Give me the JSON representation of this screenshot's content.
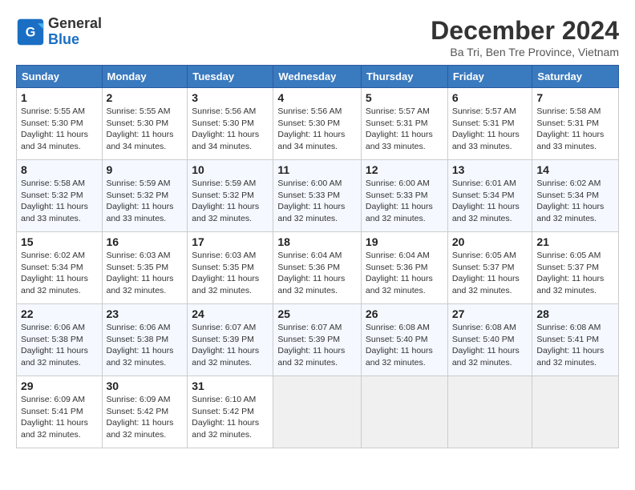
{
  "header": {
    "logo_line1": "General",
    "logo_line2": "Blue",
    "month_title": "December 2024",
    "location": "Ba Tri, Ben Tre Province, Vietnam"
  },
  "weekdays": [
    "Sunday",
    "Monday",
    "Tuesday",
    "Wednesday",
    "Thursday",
    "Friday",
    "Saturday"
  ],
  "weeks": [
    [
      {
        "day": "1",
        "text": "Sunrise: 5:55 AM\nSunset: 5:30 PM\nDaylight: 11 hours\nand 34 minutes."
      },
      {
        "day": "2",
        "text": "Sunrise: 5:55 AM\nSunset: 5:30 PM\nDaylight: 11 hours\nand 34 minutes."
      },
      {
        "day": "3",
        "text": "Sunrise: 5:56 AM\nSunset: 5:30 PM\nDaylight: 11 hours\nand 34 minutes."
      },
      {
        "day": "4",
        "text": "Sunrise: 5:56 AM\nSunset: 5:30 PM\nDaylight: 11 hours\nand 34 minutes."
      },
      {
        "day": "5",
        "text": "Sunrise: 5:57 AM\nSunset: 5:31 PM\nDaylight: 11 hours\nand 33 minutes."
      },
      {
        "day": "6",
        "text": "Sunrise: 5:57 AM\nSunset: 5:31 PM\nDaylight: 11 hours\nand 33 minutes."
      },
      {
        "day": "7",
        "text": "Sunrise: 5:58 AM\nSunset: 5:31 PM\nDaylight: 11 hours\nand 33 minutes."
      }
    ],
    [
      {
        "day": "8",
        "text": "Sunrise: 5:58 AM\nSunset: 5:32 PM\nDaylight: 11 hours\nand 33 minutes."
      },
      {
        "day": "9",
        "text": "Sunrise: 5:59 AM\nSunset: 5:32 PM\nDaylight: 11 hours\nand 33 minutes."
      },
      {
        "day": "10",
        "text": "Sunrise: 5:59 AM\nSunset: 5:32 PM\nDaylight: 11 hours\nand 32 minutes."
      },
      {
        "day": "11",
        "text": "Sunrise: 6:00 AM\nSunset: 5:33 PM\nDaylight: 11 hours\nand 32 minutes."
      },
      {
        "day": "12",
        "text": "Sunrise: 6:00 AM\nSunset: 5:33 PM\nDaylight: 11 hours\nand 32 minutes."
      },
      {
        "day": "13",
        "text": "Sunrise: 6:01 AM\nSunset: 5:34 PM\nDaylight: 11 hours\nand 32 minutes."
      },
      {
        "day": "14",
        "text": "Sunrise: 6:02 AM\nSunset: 5:34 PM\nDaylight: 11 hours\nand 32 minutes."
      }
    ],
    [
      {
        "day": "15",
        "text": "Sunrise: 6:02 AM\nSunset: 5:34 PM\nDaylight: 11 hours\nand 32 minutes."
      },
      {
        "day": "16",
        "text": "Sunrise: 6:03 AM\nSunset: 5:35 PM\nDaylight: 11 hours\nand 32 minutes."
      },
      {
        "day": "17",
        "text": "Sunrise: 6:03 AM\nSunset: 5:35 PM\nDaylight: 11 hours\nand 32 minutes."
      },
      {
        "day": "18",
        "text": "Sunrise: 6:04 AM\nSunset: 5:36 PM\nDaylight: 11 hours\nand 32 minutes."
      },
      {
        "day": "19",
        "text": "Sunrise: 6:04 AM\nSunset: 5:36 PM\nDaylight: 11 hours\nand 32 minutes."
      },
      {
        "day": "20",
        "text": "Sunrise: 6:05 AM\nSunset: 5:37 PM\nDaylight: 11 hours\nand 32 minutes."
      },
      {
        "day": "21",
        "text": "Sunrise: 6:05 AM\nSunset: 5:37 PM\nDaylight: 11 hours\nand 32 minutes."
      }
    ],
    [
      {
        "day": "22",
        "text": "Sunrise: 6:06 AM\nSunset: 5:38 PM\nDaylight: 11 hours\nand 32 minutes."
      },
      {
        "day": "23",
        "text": "Sunrise: 6:06 AM\nSunset: 5:38 PM\nDaylight: 11 hours\nand 32 minutes."
      },
      {
        "day": "24",
        "text": "Sunrise: 6:07 AM\nSunset: 5:39 PM\nDaylight: 11 hours\nand 32 minutes."
      },
      {
        "day": "25",
        "text": "Sunrise: 6:07 AM\nSunset: 5:39 PM\nDaylight: 11 hours\nand 32 minutes."
      },
      {
        "day": "26",
        "text": "Sunrise: 6:08 AM\nSunset: 5:40 PM\nDaylight: 11 hours\nand 32 minutes."
      },
      {
        "day": "27",
        "text": "Sunrise: 6:08 AM\nSunset: 5:40 PM\nDaylight: 11 hours\nand 32 minutes."
      },
      {
        "day": "28",
        "text": "Sunrise: 6:08 AM\nSunset: 5:41 PM\nDaylight: 11 hours\nand 32 minutes."
      }
    ],
    [
      {
        "day": "29",
        "text": "Sunrise: 6:09 AM\nSunset: 5:41 PM\nDaylight: 11 hours\nand 32 minutes."
      },
      {
        "day": "30",
        "text": "Sunrise: 6:09 AM\nSunset: 5:42 PM\nDaylight: 11 hours\nand 32 minutes."
      },
      {
        "day": "31",
        "text": "Sunrise: 6:10 AM\nSunset: 5:42 PM\nDaylight: 11 hours\nand 32 minutes."
      },
      null,
      null,
      null,
      null
    ]
  ]
}
